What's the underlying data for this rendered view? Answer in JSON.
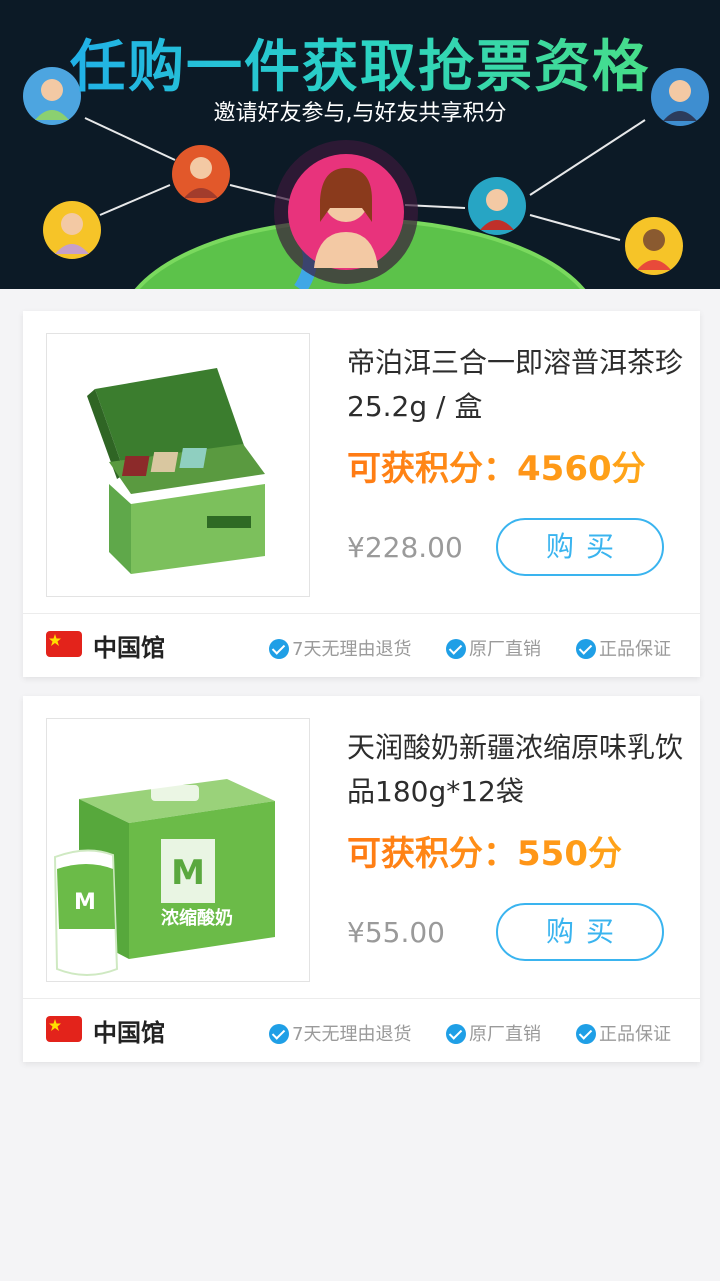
{
  "banner": {
    "title": "任购一件获取抢票资格",
    "subtitle": "邀请好友参与,与好友共享积分"
  },
  "products": [
    {
      "title": "帝泊洱三合一即溶普洱茶珍 25.2g / 盒",
      "points": "可获积分：4560分",
      "price": "¥228.00",
      "buy_label": "购买",
      "image_icon": "tea-gift-box-image",
      "origin": "中国馆",
      "badges": [
        "7天无理由退货",
        "原厂直销",
        "正品保证"
      ]
    },
    {
      "title": "天润酸奶新疆浓缩原味乳饮品180g*12袋",
      "points": "可获积分：550分",
      "price": "¥55.00",
      "buy_label": "购买",
      "image_icon": "yogurt-box-image",
      "image_text": "浓缩酸奶",
      "origin": "中国馆",
      "badges": [
        "7天无理由退货",
        "原厂直销",
        "正品保证"
      ]
    }
  ],
  "colors": {
    "accent_blue": "#3ab4ef",
    "points_orange": "#ff8c1a",
    "flag_red": "#e3231b"
  }
}
